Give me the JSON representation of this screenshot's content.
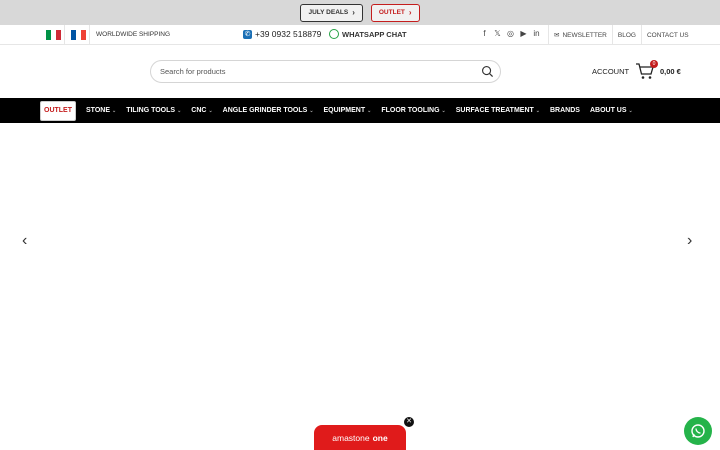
{
  "promo": {
    "deals_label": "JULY DEALS",
    "outlet_label": "OUTLET"
  },
  "topbar": {
    "shipping": "WORLDWIDE SHIPPING",
    "phone": "+39 0932 518879",
    "whatsapp": "WHATSAPP CHAT",
    "newsletter": "NEWSLETTER",
    "blog": "BLOG",
    "contact": "CONTACT US"
  },
  "header": {
    "search_placeholder": "Search for products",
    "account": "ACCOUNT",
    "cart_count": "0",
    "cart_total": "0,00 €"
  },
  "nav": {
    "items": [
      {
        "label": "OUTLET"
      },
      {
        "label": "STONE"
      },
      {
        "label": "TILING TOOLS"
      },
      {
        "label": "CNC"
      },
      {
        "label": "ANGLE GRINDER TOOLS"
      },
      {
        "label": "EQUIPMENT"
      },
      {
        "label": "FLOOR TOOLING"
      },
      {
        "label": "SURFACE TREATMENT"
      },
      {
        "label": "BRANDS"
      },
      {
        "label": "ABOUT US"
      }
    ]
  },
  "widget": {
    "brand_prefix": "amastone",
    "brand_suffix": "one"
  },
  "colors": {
    "accent": "#c41d1d",
    "nav_bg": "#000000",
    "whatsapp": "#25b34a",
    "pill": "#e01b1b"
  }
}
